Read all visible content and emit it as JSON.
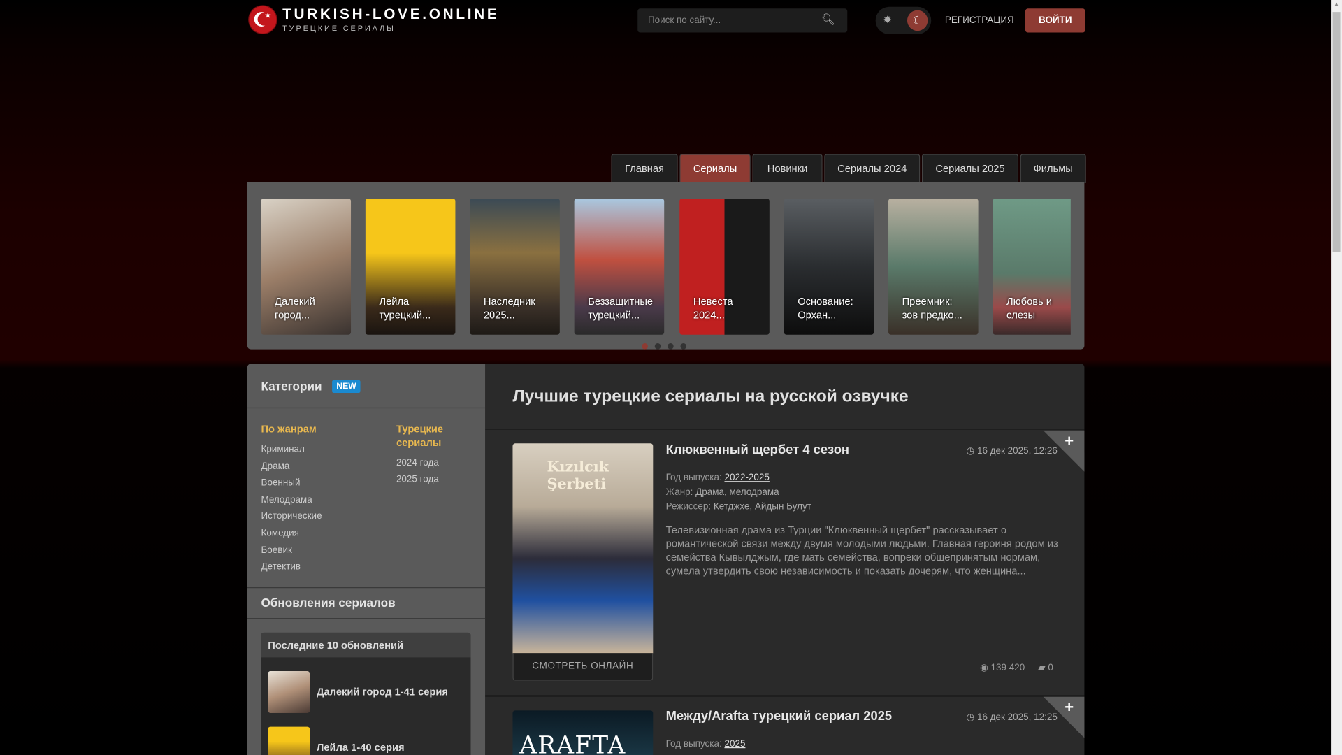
{
  "header": {
    "site_title": "TURKISH-LOVE.ONLINE",
    "site_subtitle": "ТУРЕЦКИЕ СЕРИАЛЫ",
    "search_placeholder": "Поиск по сайту...",
    "register": "РЕГИСТРАЦИЯ",
    "login": "ВОЙТИ"
  },
  "nav": [
    {
      "label": "Главная",
      "active": false
    },
    {
      "label": "Сериалы",
      "active": true
    },
    {
      "label": "Новинки",
      "active": false
    },
    {
      "label": "Сериалы 2024",
      "active": false
    },
    {
      "label": "Сериалы 2025",
      "active": false
    },
    {
      "label": "Фильмы",
      "active": false
    }
  ],
  "carousel": {
    "items": [
      {
        "title": "Далекий город..."
      },
      {
        "title": "Лейла турецкий..."
      },
      {
        "title": "Наследник 2025..."
      },
      {
        "title": "Беззащитные турецкий..."
      },
      {
        "title": "Невеста 2024..."
      },
      {
        "title": "Основание: Орхан..."
      },
      {
        "title": "Преемник: зов предко..."
      },
      {
        "title": "Любовь и слезы"
      }
    ],
    "active_page": 1,
    "pages": 4
  },
  "sidebar": {
    "categories_title": "Категории",
    "badge": "NEW",
    "genres_title": "По жанрам",
    "genres": [
      "Криминал",
      "Драма",
      "Военный",
      "Мелодрама",
      "Исторические",
      "Комедия",
      "Боевик",
      "Детектив"
    ],
    "turkish_title": "Турецкие сериалы",
    "turkish": [
      "2024 года",
      "2025 года"
    ],
    "updates_title": "Обновления сериалов",
    "last_updates_title": "Последние 10 обновлений",
    "updates": [
      {
        "title": "Далекий город 1-41 серия"
      },
      {
        "title": "Лейла 1-40 серия"
      }
    ]
  },
  "main": {
    "heading": "Лучшие турецкие сериалы на русской озвучке",
    "watch_label": "СМОТРЕТЬ ОНЛАЙН",
    "year_label": "Год выпуска:",
    "genre_label": "Жанр:",
    "director_label": "Режиссер:",
    "posts": [
      {
        "title": "Клюквенный щербет 4 сезон",
        "date": "16 дек 2025, 12:26",
        "year": "2022-2025",
        "genre": "Драма, мелодрама",
        "director": "Кетджхе, Айдын Булут",
        "description": "Телевизионная драма из Турции \"Клюквенный щербет\" рассказывает о романтической связи между двумя молодыми людьми. Главная героиня родом из семейства Кывылджым, где мать семейства, вопреки общепринятым нормам, сумела утвердить свою независимость и показать дочерям, что женщина...",
        "views": "139 420",
        "comments": "0",
        "poster_text": "Kızılcık Şerbeti"
      },
      {
        "title": "Между/Arafta турецкий сериал 2025",
        "date": "16 дек 2025, 12:25",
        "year": "2025",
        "poster_text": "ARAFTA"
      }
    ]
  }
}
